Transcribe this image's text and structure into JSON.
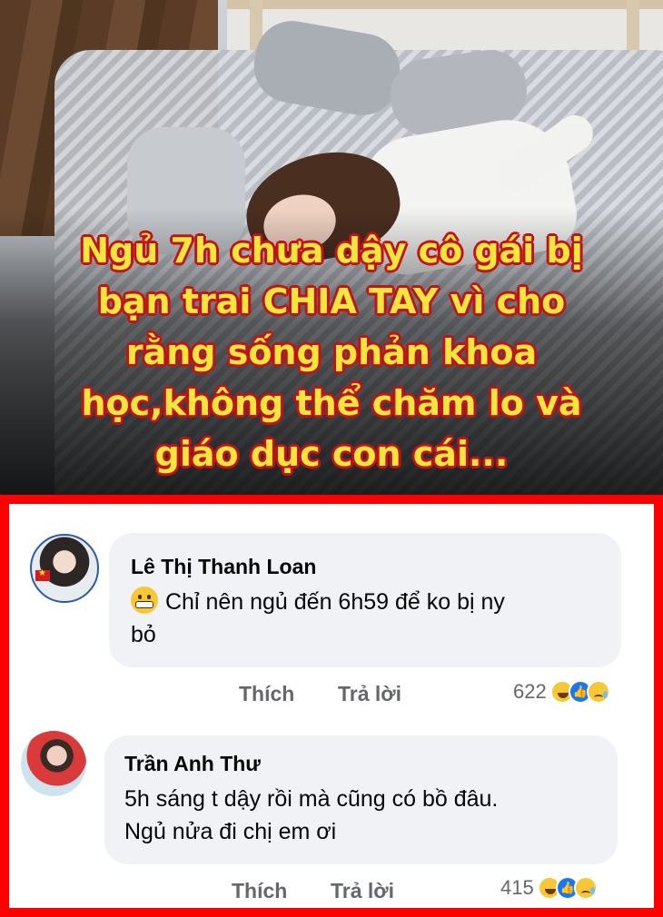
{
  "headline": {
    "lines": [
      "Ngủ 7h chưa dậy cô gái bị",
      "bạn trai CHIA TAY vì cho",
      "rằng sống phản khoa",
      "học,không thể chăm lo và",
      "giáo dục con cái..."
    ]
  },
  "colors": {
    "headline_fill": "#f5e63b",
    "headline_stroke": "#c1121b",
    "panel_border": "#ff0000",
    "bubble_bg": "#f0f2f5"
  },
  "comments": [
    {
      "author": "Lê Thị Thanh Loan",
      "emoji": "grimacing-emoji",
      "text_line1": "Chỉ nên ngủ đến 6h59 để ko bị ny",
      "text_line2": "bỏ",
      "like_label": "Thích",
      "reply_label": "Trả lời",
      "reaction_count": "622",
      "reactions": [
        "haha",
        "like",
        "sad"
      ]
    },
    {
      "author": "Trần Anh Thư",
      "text_line1": "5h sáng t dậy rồi mà cũng có bồ đâu.",
      "text_line2": "Ngủ nửa đi chị em ơi",
      "like_label": "Thích",
      "reply_label": "Trả lời",
      "reaction_count": "415",
      "reactions": [
        "haha",
        "like",
        "sad"
      ]
    }
  ]
}
